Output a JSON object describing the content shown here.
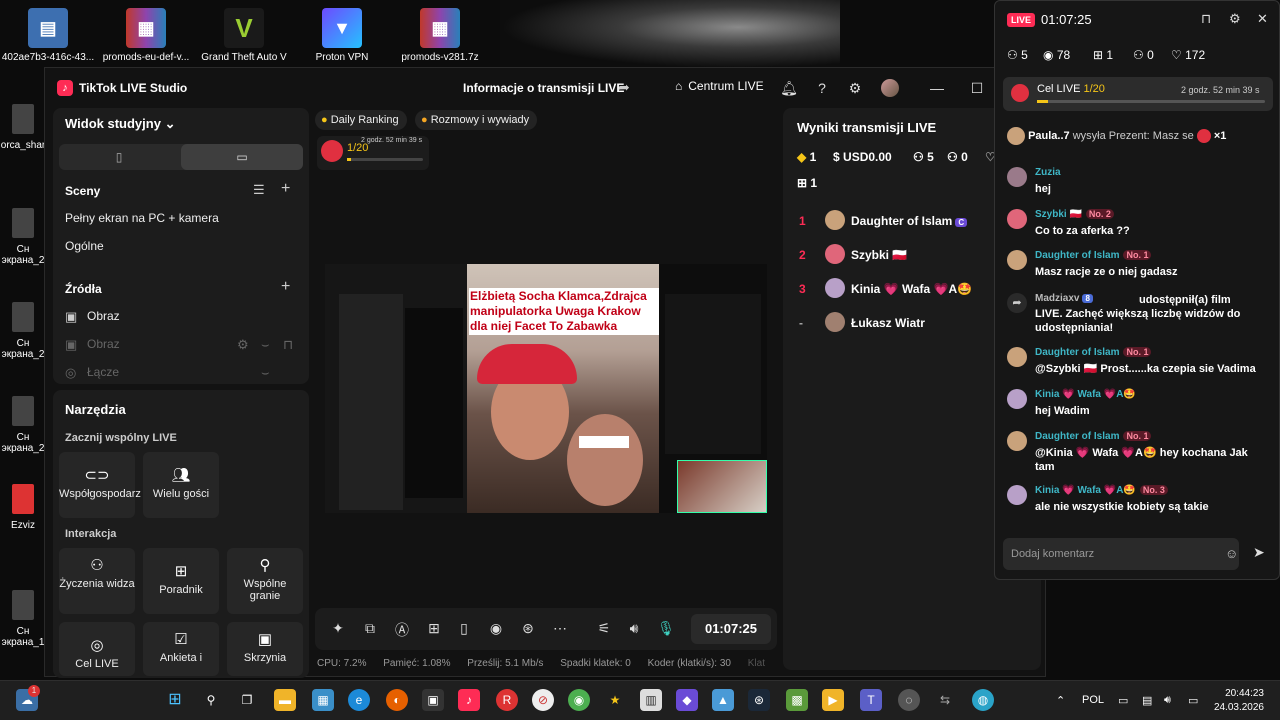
{
  "desktop": {
    "icons": [
      {
        "label": "402ae7b3-416c-43...",
        "icon": "file-icon"
      },
      {
        "label": "promods-eu-def-v...",
        "icon": "winrar-icon"
      },
      {
        "label": "Grand Theft Auto V",
        "icon": "gta-icon"
      },
      {
        "label": "Proton VPN",
        "icon": "protonvpn-icon"
      },
      {
        "label": "promods-v281.7z",
        "icon": "winrar-icon"
      }
    ],
    "left_icons": [
      "orca_shar",
      "Сн экрана_2",
      "Сн экрана_2",
      "Сн экрана_2",
      "Ezviz",
      "Сн экрана_1"
    ]
  },
  "studio": {
    "app_title": "TikTok LIVE Studio",
    "live_info": "Informacje o transmisji LIVE",
    "centrum": "Centrum LIVE",
    "left": {
      "view_label": "Widok studyjny",
      "scenes_title": "Sceny",
      "scenes": [
        "Pełny ekran na PC + kamera",
        "Ogólne"
      ],
      "sources_title": "Źródła",
      "sources": [
        "Obraz",
        "Obraz",
        "Łącze"
      ],
      "tools_title": "Narzędzia",
      "collab_title": "Zacznij wspólny LIVE",
      "collab": [
        "Współgospodarz",
        "Wielu gości"
      ],
      "interaction_title": "Interakcja",
      "interaction": [
        "Życzenia widza",
        "Poradnik",
        "Wspólne granie",
        "Cel LIVE",
        "Ankieta i",
        "Skrzynia"
      ]
    },
    "center": {
      "pills": [
        "Daily Ranking",
        "Rozmowy i wywiady"
      ],
      "goal_progress": "1/20",
      "goal_time": "2 godz. 52 min 39 s",
      "preview_caption": "Elżbietą Socha Klamca,Zdrajca manipulatorka Uwaga Krakow dla niej Facet To Zabawka",
      "timer": "01:07:25",
      "stats": {
        "cpu": "CPU: 7.2%",
        "memory": "Pamięć: 1.08%",
        "upload": "Prześlij: 5.1 Mb/s",
        "dropped": "Spadki klatek: 0",
        "encoder": "Koder (klatki/s): 30",
        "more": "Klat"
      }
    },
    "results": {
      "title": "Wyniki transmisji LIVE",
      "diamonds": "1",
      "usd": "USD0.00",
      "viewers": "5",
      "follows": "0",
      "likes": "172",
      "gifts": "1",
      "ranking": [
        {
          "rank": "1",
          "name": "Daughter of Islam",
          "extra": "C"
        },
        {
          "rank": "2",
          "name": "Szybki 🇵🇱",
          "extra": ""
        },
        {
          "rank": "3",
          "name": "Kinia 💗 Wafa 💗A🤩",
          "extra": ""
        },
        {
          "rank": "-",
          "name": "Łukasz Wiatr",
          "extra": ""
        }
      ]
    }
  },
  "chat": {
    "live_badge": "LIVE",
    "timer": "01:07:25",
    "stats": {
      "viewers": "5",
      "views": "78",
      "gifts": "1",
      "follows": "0",
      "likes": "172"
    },
    "goal": {
      "label": "Cel LIVE",
      "progress": "1/20",
      "time": "2 godz. 52 min 39 s",
      "fraction": 0.05
    },
    "gift_notice": {
      "user": "Paula..7",
      "text": "wysyła Prezent: Masz se",
      "count": "×1"
    },
    "messages": [
      {
        "name": "Zuzia",
        "badge": "",
        "text": "hej"
      },
      {
        "name": "Szybki 🇵🇱",
        "badge": "No. 2",
        "text": "Co to za aferka ??"
      },
      {
        "name": "Daughter of Islam",
        "badge": "No. 1",
        "text": "Masz racje ze o niej gadasz"
      },
      {
        "name": "Madziaxv",
        "badge": "8",
        "text": "udostępnił(a) film LIVE. Zachęć większą liczbę widzów do udostępniania!"
      },
      {
        "name": "Daughter of Islam",
        "badge": "No. 1",
        "text": "@Szybki 🇵🇱 Prost......ka czepia sie Vadima"
      },
      {
        "name": "Kinia 💗 Wafa 💗A🤩",
        "badge": "",
        "text": "hej Wadim"
      },
      {
        "name": "Daughter of Islam",
        "badge": "No. 1",
        "text": "@Kinia 💗 Wafa 💗A🤩 hey kochana Jak tam"
      },
      {
        "name": "Kinia 💗 Wafa 💗A🤩",
        "badge": "No. 3",
        "text": "ale nie wszystkie kobiety są takie"
      }
    ],
    "comment_placeholder": "Dodaj komentarz"
  },
  "taskbar": {
    "lang": "POL",
    "time": "20:44:23",
    "date": "24.03.2026",
    "notify_count": "1"
  }
}
